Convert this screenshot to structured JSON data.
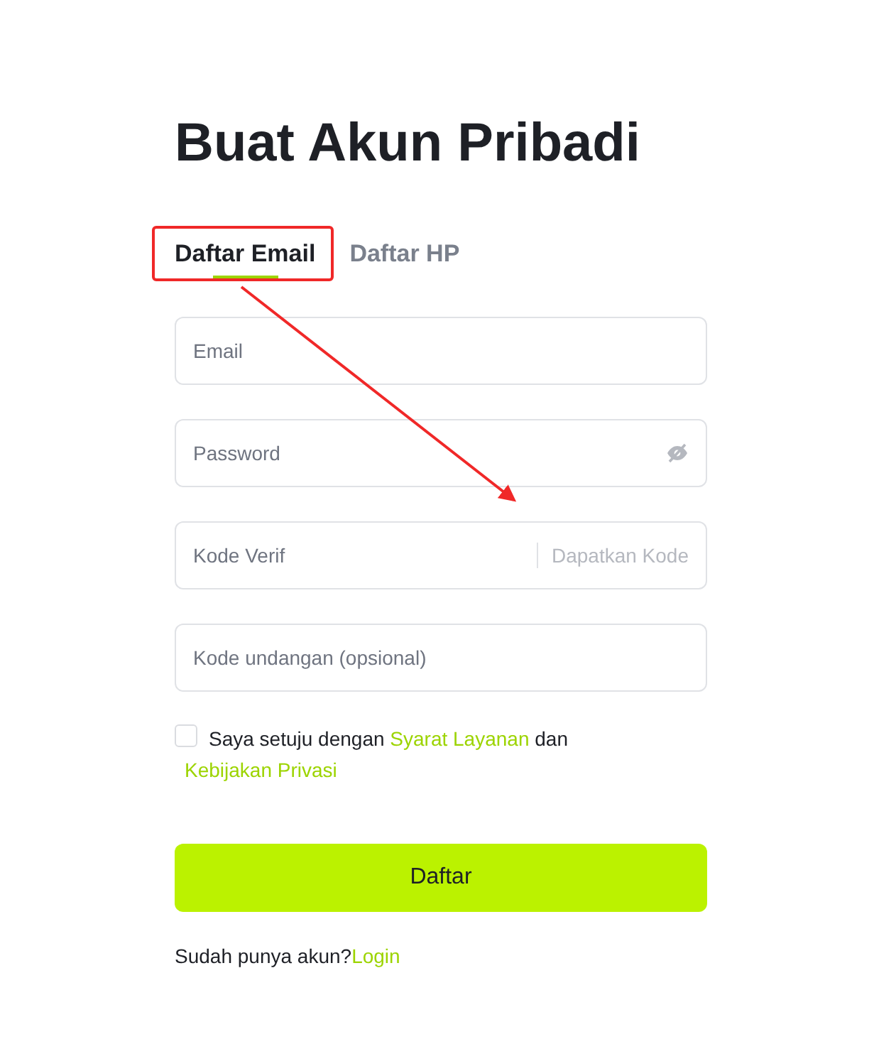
{
  "title": "Buat Akun Pribadi",
  "tabs": [
    {
      "label": "Daftar Email",
      "selected": true
    },
    {
      "label": "Daftar HP",
      "selected": false
    }
  ],
  "fields": [
    {
      "kind": "text",
      "placeholder": "Email"
    },
    {
      "kind": "password",
      "placeholder": "Password"
    },
    {
      "kind": "code",
      "placeholder": "Kode Verif",
      "action": "Dapatkan Kode"
    },
    {
      "kind": "text",
      "placeholder": "Kode undangan (opsional)"
    }
  ],
  "agreement": {
    "checked": false,
    "text": "Saya setuju dengan",
    "terms_link": "Syarat Layanan",
    "joiner": "dan",
    "privacy_link": "Kebijakan Privasi"
  },
  "submit": "Daftar",
  "footer": {
    "text": "Sudah punya akun?",
    "link": "Login"
  }
}
